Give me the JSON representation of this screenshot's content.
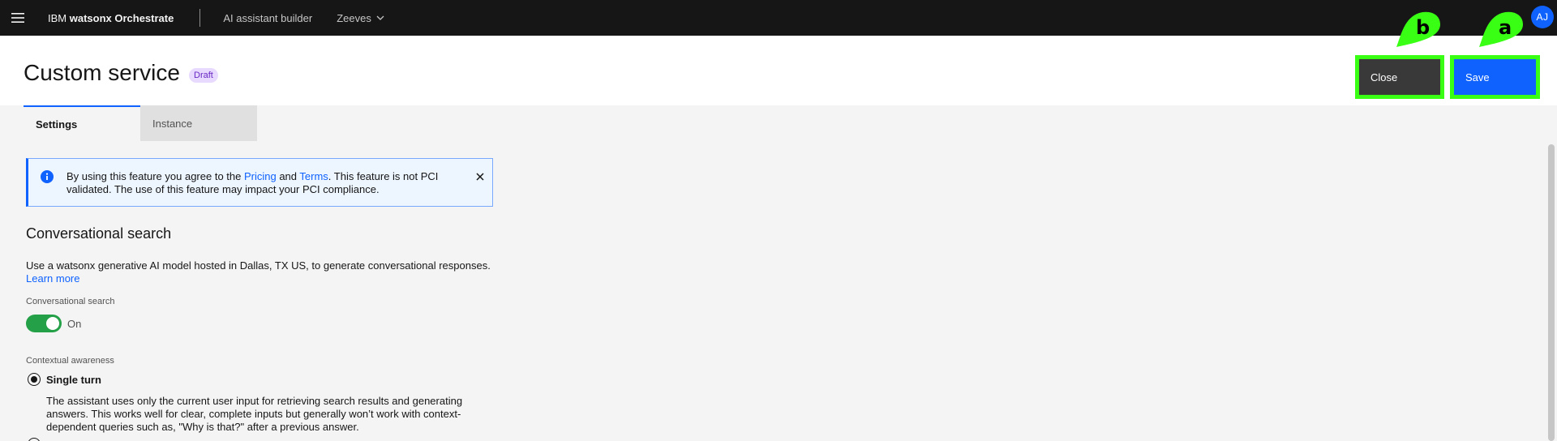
{
  "topbar": {
    "brand_prefix": "IBM ",
    "brand_name": "watsonx Orchestrate",
    "nav_link": "AI assistant builder",
    "workspace": "Zeeves",
    "avatar": "AJ"
  },
  "header": {
    "title": "Custom service",
    "tag": "Draft",
    "close_label": "Close",
    "save_label": "Save",
    "marker_close": "b",
    "marker_save": "a"
  },
  "tabs": [
    {
      "label": "Settings"
    },
    {
      "label": "Instance"
    }
  ],
  "notice": {
    "text_1": "By using this feature you agree to the ",
    "link_pricing": "Pricing",
    "text_2": " and ",
    "link_terms": "Terms",
    "text_3": ". This feature is not PCI validated. The use of this feature may impact your PCI compliance."
  },
  "conversational_search": {
    "title": "Conversational search",
    "description": "Use a watsonx generative AI model hosted in Dallas, TX US, to generate conversational responses.",
    "learn_more": "Learn more",
    "toggle_label": "Conversational search",
    "toggle_state": "On",
    "contextual_label": "Contextual awareness",
    "option_label": "Single turn",
    "option_desc": "The assistant uses only the current user input for retrieving search results and generating answers. This works well for clear, complete inputs but generally won’t work with context-dependent queries such as, \"Why is that?\" after a previous answer."
  },
  "colors": {
    "primary": "#0f62fe",
    "highlight": "#39ff14",
    "toggle_on": "#24a148"
  }
}
